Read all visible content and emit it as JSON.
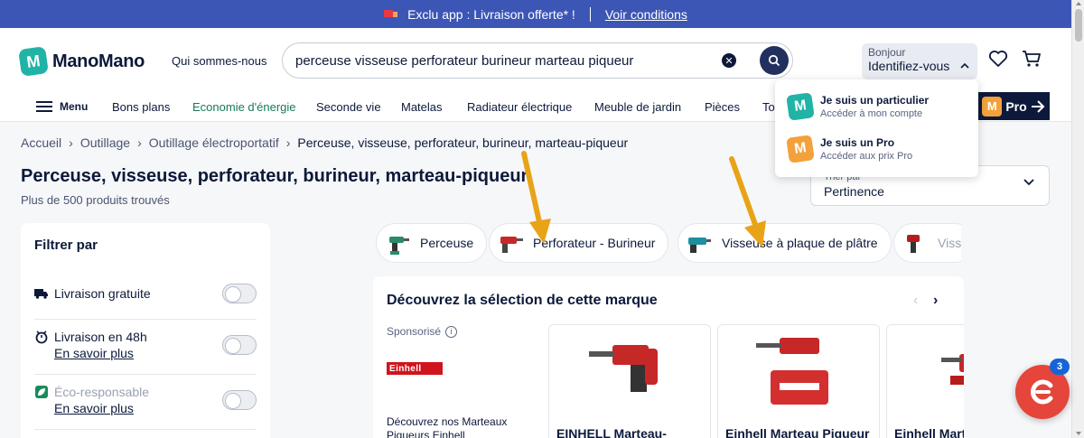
{
  "promo": {
    "text": "Exclu app : Livraison offerte* !",
    "link": "Voir conditions"
  },
  "header": {
    "logo": "ManoMano",
    "logo_letter": "M",
    "who": "Qui sommes-nous",
    "search_value": "perceuse visseuse perforateur burineur marteau piqueur",
    "account_hello": "Bonjour",
    "account_ident": "Identifiez-vous"
  },
  "nav": {
    "menu": "Menu",
    "items": [
      "Bons plans",
      "Economie d'énergie",
      "Seconde vie",
      "Matelas",
      "Radiateur électrique",
      "Meuble de jardin",
      "Pièces",
      "To"
    ],
    "pro_label": "Pro"
  },
  "dropdown": {
    "items": [
      {
        "title": "Je suis un particulier",
        "sub": "Accéder à mon compte",
        "color": "#22b3a7"
      },
      {
        "title": "Je suis un Pro",
        "sub": "Accéder aux prix Pro",
        "color": "#f3a13b"
      }
    ]
  },
  "breadcrumb": [
    "Accueil",
    "Outillage",
    "Outillage électroportatif",
    "Perceuse, visseuse, perforateur, burineur, marteau-piqueur"
  ],
  "page": {
    "title": "Perceuse, visseuse, perforateur, burineur, marteau-piqueur",
    "count": "Plus de 500 produits trouvés"
  },
  "sort": {
    "label": "Trier par",
    "value": "Pertinence"
  },
  "filter": {
    "title": "Filtrer par",
    "rows": [
      {
        "label": "Livraison gratuite",
        "link": ""
      },
      {
        "label": "Livraison en 48h",
        "link": "En savoir plus"
      },
      {
        "label": "Éco-responsable",
        "link": "En savoir plus"
      }
    ]
  },
  "chips": [
    "Perceuse",
    "Perforateur - Burineur",
    "Visseuse à plaque de plâtre",
    "Viss"
  ],
  "brand": {
    "heading": "Découvrez la sélection de cette marque",
    "sponsored": "Sponsorisé",
    "logo": "Einhell",
    "desc": "Découvrez nos Marteaux Piqueurs Einhell",
    "products": [
      "EINHELL Marteau-",
      "Einhell Marteau Piqueur",
      "Einhell Mart"
    ]
  },
  "chat_badge": "3",
  "colors": {
    "brand": "#22b3a7",
    "promo_bar": "#3c56b5",
    "pro": "#f3a13b",
    "chat": "#e5453a"
  }
}
